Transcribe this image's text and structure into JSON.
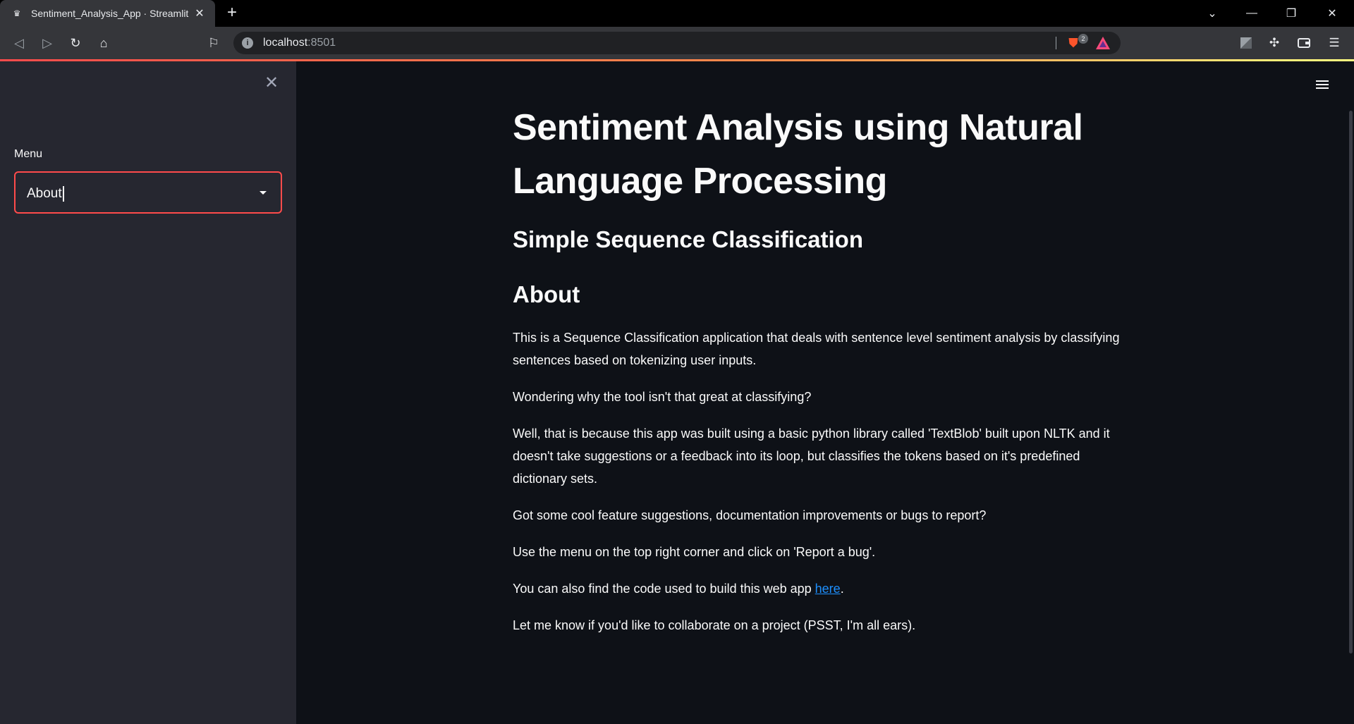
{
  "browser": {
    "tab_title": "Sentiment_Analysis_App · Streamlit",
    "url_host": "localhost",
    "url_port": ":8501",
    "shield_count": "2"
  },
  "sidebar": {
    "menu_label": "Menu",
    "select_value": "About"
  },
  "main": {
    "title": "Sentiment Analysis using Natural Language Processing",
    "subtitle": "Simple Sequence Classification",
    "section_heading": "About",
    "paragraphs": [
      "This is a Sequence Classification application that deals with sentence level sentiment analysis by classifying sentences based on tokenizing user inputs.",
      "Wondering why the tool isn't that great at classifying?",
      "Well, that is because this app was built using a basic python library called 'TextBlob' built upon NLTK and it doesn't take suggestions or a feedback into its loop, but classifies the tokens based on it's predefined dictionary sets.",
      "Got some cool feature suggestions, documentation improvements or bugs to report?",
      "Use the menu on the top right corner and click on 'Report a bug'."
    ],
    "code_line_prefix": "You can also find the code used to build this web app ",
    "code_link_text": "here",
    "code_line_suffix": ".",
    "closing": "Let me know if you'd like to collaborate on a project (PSST, I'm all ears)."
  },
  "colors": {
    "accent": "#ff4b4b",
    "sidebar_bg": "#262730",
    "main_bg": "#0e1117",
    "link": "#1e90ff"
  }
}
